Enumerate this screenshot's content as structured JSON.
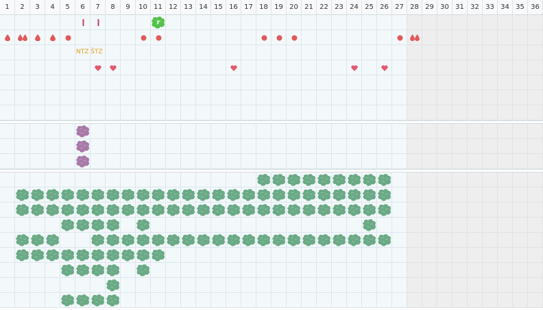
{
  "days": [
    "1",
    "2",
    "3",
    "4",
    "5",
    "6",
    "7",
    "8",
    "9",
    "10",
    "11",
    "12",
    "13",
    "14",
    "15",
    "16",
    "17",
    "18",
    "19",
    "20",
    "21",
    "22",
    "23",
    "24",
    "25",
    "26",
    "27",
    "28",
    "29",
    "30",
    "31",
    "32",
    "33",
    "34",
    "35",
    "36"
  ],
  "future_from_day": 28,
  "colors": {
    "grid_line": "#dbe7ec",
    "cell_bg": "#f3f8fa",
    "future_bg": "#eeeeee",
    "drop_red": "#e05a5a",
    "dot_red": "#e05a5a",
    "heart": "#e05a70",
    "tick": "#c04060",
    "note": "#e0a020",
    "blob_green_bright": "#55c04a",
    "blob_purple": "#a87aa8",
    "blob_green": "#6aaa86"
  },
  "rows": {
    "section1": [
      {
        "marks": [
          {
            "day": 6,
            "icon": "tick-mark"
          },
          {
            "day": 7,
            "icon": "tick-mark"
          },
          {
            "day": 11,
            "icon": "green-blob",
            "label": "r"
          }
        ]
      },
      {
        "marks": [
          {
            "day": 1,
            "icon": "drop-icon"
          },
          {
            "day": 2,
            "icon": "double-drop-icon"
          },
          {
            "day": 3,
            "icon": "drop-icon"
          },
          {
            "day": 4,
            "icon": "drop-icon"
          },
          {
            "day": 5,
            "icon": "dot-icon"
          },
          {
            "day": 10,
            "icon": "dot-icon"
          },
          {
            "day": 11,
            "icon": "dot-icon"
          },
          {
            "day": 18,
            "icon": "dot-icon"
          },
          {
            "day": 19,
            "icon": "dot-icon"
          },
          {
            "day": 20,
            "icon": "dot-icon"
          },
          {
            "day": 27,
            "icon": "dot-icon"
          },
          {
            "day": 28,
            "icon": "double-drop-icon"
          }
        ]
      },
      {
        "marks": [],
        "note": {
          "day": 6,
          "text": "NTZ ŠTZ"
        }
      },
      {
        "marks": [
          {
            "day": 7,
            "icon": "heart-icon"
          },
          {
            "day": 8,
            "icon": "heart-icon"
          },
          {
            "day": 16,
            "icon": "heart-icon"
          },
          {
            "day": 24,
            "icon": "heart-icon"
          },
          {
            "day": 26,
            "icon": "heart-icon"
          }
        ]
      },
      {
        "marks": []
      },
      {
        "marks": []
      },
      {
        "marks": []
      }
    ],
    "section2": [
      {
        "blobs": [
          6
        ]
      },
      {
        "blobs": [
          6
        ]
      },
      {
        "blobs": [
          6
        ]
      }
    ],
    "section3": [
      {
        "blobs": [
          18,
          19,
          20,
          21,
          22,
          23,
          24,
          25,
          26
        ]
      },
      {
        "blobs": [
          2,
          3,
          4,
          5,
          6,
          7,
          8,
          9,
          10,
          11,
          12,
          13,
          14,
          15,
          16,
          17,
          18,
          19,
          20,
          21,
          22,
          23,
          24,
          25,
          26
        ]
      },
      {
        "blobs": [
          2,
          3,
          4,
          5,
          6,
          7,
          8,
          9,
          10,
          11,
          12,
          13,
          14,
          15,
          16,
          17,
          18,
          19,
          20,
          21,
          22,
          23,
          24,
          25,
          26
        ]
      },
      {
        "blobs": [
          5,
          6,
          7,
          8,
          10,
          25
        ]
      },
      {
        "blobs": [
          2,
          3,
          4,
          7,
          8,
          9,
          10,
          11,
          12,
          13,
          14,
          15,
          16,
          17,
          18,
          19,
          20,
          21,
          22,
          23,
          24,
          25,
          26
        ]
      },
      {
        "blobs": [
          2,
          3,
          4,
          5,
          6,
          7,
          8,
          9,
          10,
          11
        ]
      },
      {
        "blobs": [
          5,
          6,
          7,
          8,
          10
        ]
      },
      {
        "blobs": [
          8
        ]
      },
      {
        "blobs": [
          5,
          6,
          7,
          8
        ]
      }
    ]
  }
}
